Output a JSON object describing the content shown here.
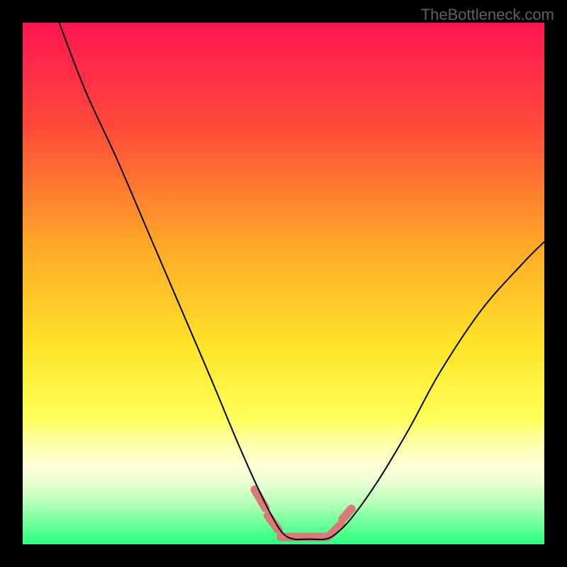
{
  "watermark": "TheBottleneck.com",
  "chart_data": {
    "type": "line",
    "title": "",
    "xlabel": "",
    "ylabel": "",
    "xlim": [
      0,
      100
    ],
    "ylim": [
      0,
      100
    ],
    "background_gradient_stops": [
      {
        "offset": 0,
        "color": "#ff1452"
      },
      {
        "offset": 20,
        "color": "#ff4a3a"
      },
      {
        "offset": 42,
        "color": "#ffa528"
      },
      {
        "offset": 62,
        "color": "#ffe428"
      },
      {
        "offset": 76,
        "color": "#ffff5a"
      },
      {
        "offset": 80,
        "color": "#ffffa0"
      },
      {
        "offset": 85,
        "color": "#ffffd8"
      },
      {
        "offset": 88,
        "color": "#ecffd5"
      },
      {
        "offset": 92,
        "color": "#b8ffb8"
      },
      {
        "offset": 96,
        "color": "#6eff9a"
      },
      {
        "offset": 100,
        "color": "#2dff82"
      }
    ],
    "series": [
      {
        "name": "bottleneck-curve",
        "stroke": "#000000",
        "stroke_width": 2,
        "x": [
          7,
          12,
          18,
          24,
          30,
          36,
          41,
          45,
          48,
          50,
          52,
          55,
          58,
          60,
          63,
          68,
          74,
          80,
          88,
          96,
          100
        ],
        "y": [
          100,
          87,
          74,
          60,
          46,
          32,
          20,
          11,
          5,
          2,
          1,
          1,
          1,
          2,
          5,
          12,
          22,
          33,
          45,
          54,
          58
        ]
      },
      {
        "name": "highlight-band",
        "stroke": "#d87a78",
        "stroke_width": 12,
        "linecap": "round",
        "segments": [
          {
            "x": [
              44.5,
              46.5
            ],
            "y": [
              10.5,
              7.0
            ]
          },
          {
            "x": [
              47.0,
              49.0
            ],
            "y": [
              5.5,
              2.8
            ]
          },
          {
            "x": [
              49.5,
              58.5
            ],
            "y": [
              1.4,
              1.4
            ]
          },
          {
            "x": [
              59.0,
              61.0
            ],
            "y": [
              1.8,
              3.8
            ]
          },
          {
            "x": [
              61.3,
              63.0
            ],
            "y": [
              4.8,
              6.8
            ]
          }
        ]
      }
    ]
  }
}
